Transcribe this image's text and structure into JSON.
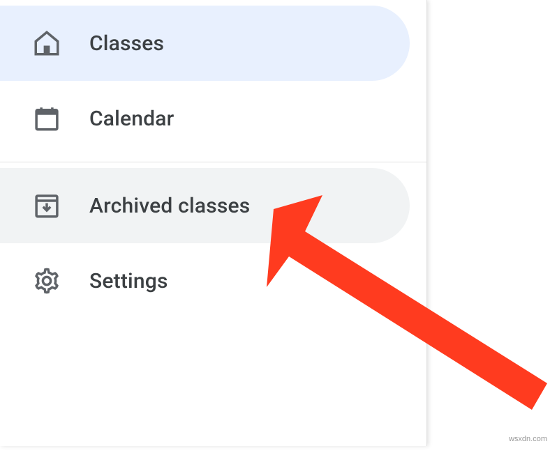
{
  "sidebar": {
    "items": [
      {
        "label": "Classes",
        "icon": "home-icon",
        "selected": true
      },
      {
        "label": "Calendar",
        "icon": "calendar-icon",
        "selected": false
      },
      {
        "label": "Archived classes",
        "icon": "archive-icon",
        "selected": false,
        "hover": true
      },
      {
        "label": "Settings",
        "icon": "gear-icon",
        "selected": false
      }
    ]
  },
  "watermark": "wsxdn.com",
  "annotation": {
    "arrow_color": "#ff3b1f"
  }
}
